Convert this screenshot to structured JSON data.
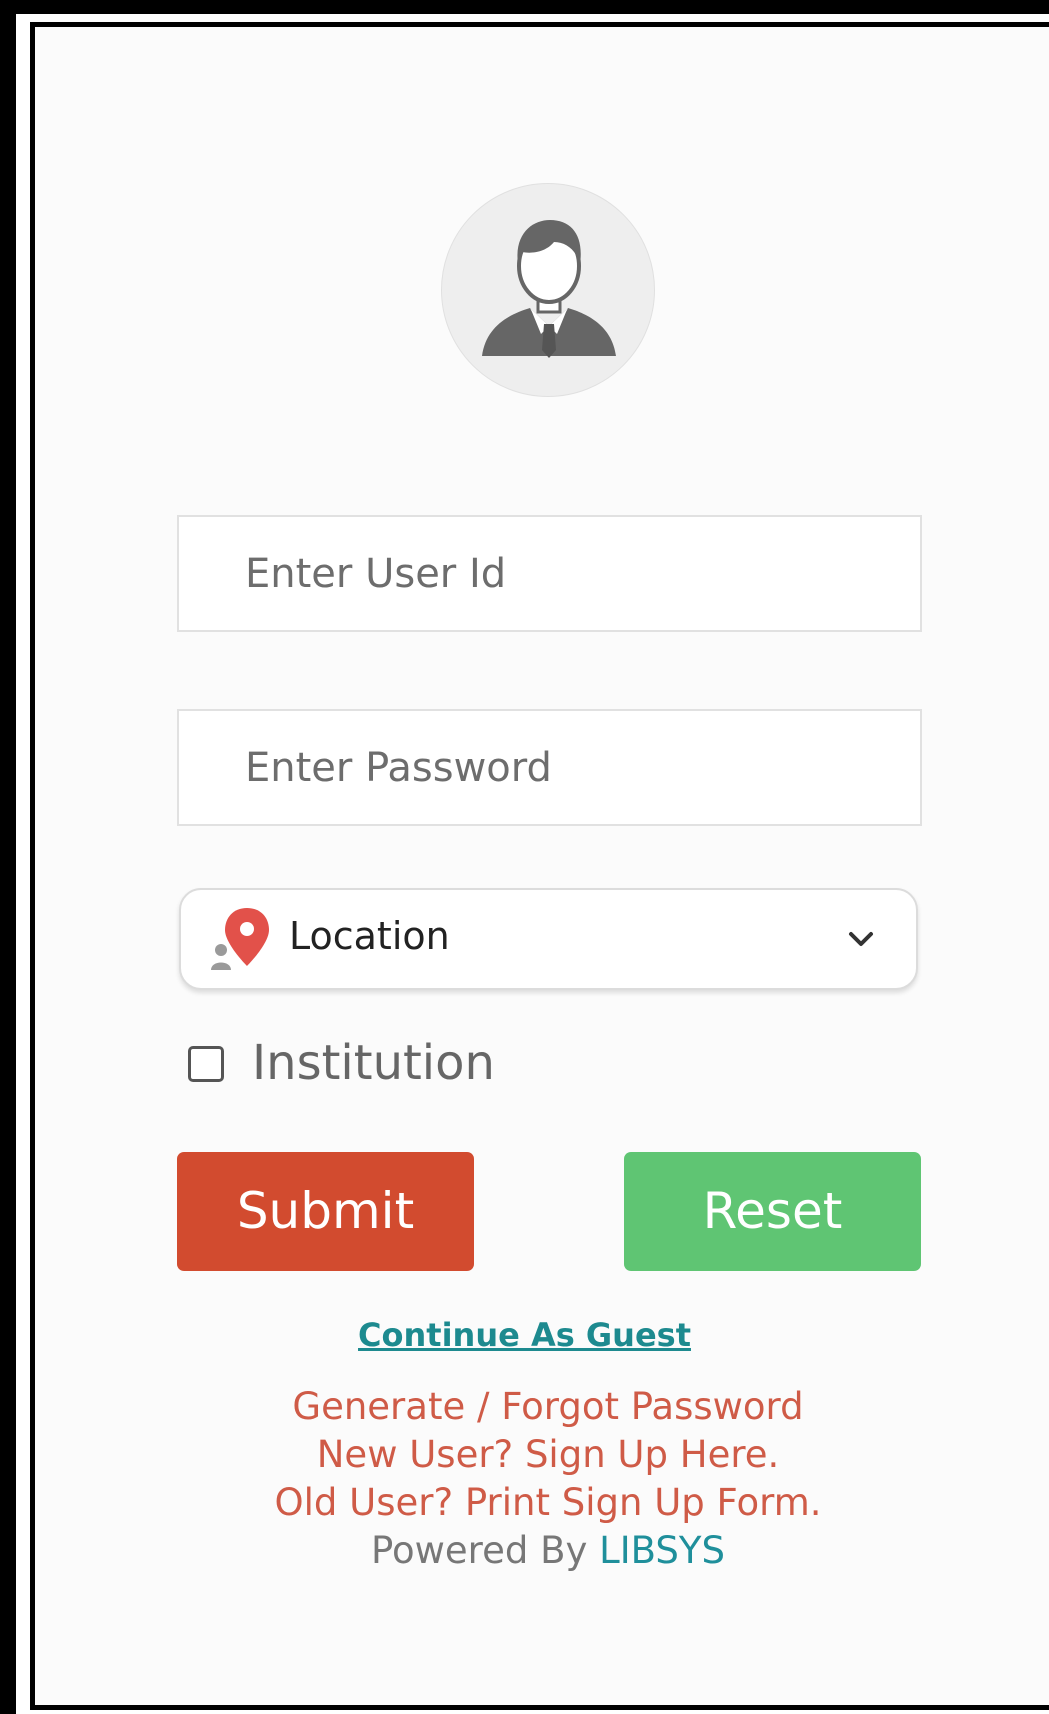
{
  "login": {
    "userid_placeholder": "Enter User Id",
    "password_placeholder": "Enter Password",
    "location_label": "Location",
    "institution_label": "Institution",
    "institution_checked": false,
    "submit_label": "Submit",
    "reset_label": "Reset",
    "guest_link": "Continue As Guest",
    "forgot_link": "Generate / Forgot Password",
    "signup_link": "New User? Sign Up Here.",
    "print_form_link": "Old User? Print Sign Up Form.",
    "powered_by_text": "Powered By",
    "powered_by_brand": "LIBSYS"
  },
  "icons": {
    "avatar": "user-avatar-icon",
    "location": "location-pin-icon",
    "dropdown": "chevron-down-icon"
  },
  "colors": {
    "submit": "#d24b2f",
    "reset": "#5fc573",
    "link_red": "#cf5b47",
    "link_teal": "#1d8a8f"
  }
}
